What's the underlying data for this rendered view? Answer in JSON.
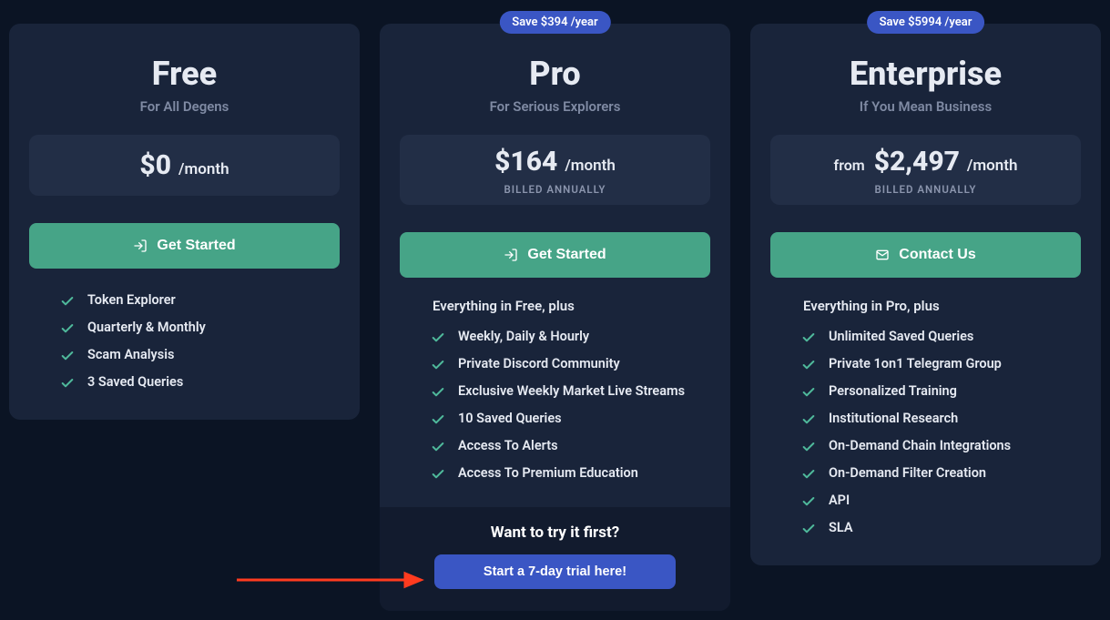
{
  "plans": {
    "free": {
      "title": "Free",
      "subtitle": "For All Degens",
      "price_amount": "$0",
      "price_period": "/month",
      "cta_label": "Get Started",
      "features": [
        "Token Explorer",
        "Quarterly & Monthly",
        "Scam Analysis",
        "3 Saved Queries"
      ]
    },
    "pro": {
      "badge": "Save $394 /year",
      "title": "Pro",
      "subtitle": "For Serious Explorers",
      "price_amount": "$164",
      "price_period": "/month",
      "billed": "BILLED ANNUALLY",
      "cta_label": "Get Started",
      "intro": "Everything in Free, plus",
      "features": [
        "Weekly, Daily & Hourly",
        "Private Discord Community",
        "Exclusive Weekly Market Live Streams",
        "10 Saved Queries",
        "Access To Alerts",
        "Access To Premium Education"
      ],
      "try_title": "Want to try it first?",
      "trial_label": "Start a 7-day trial here!"
    },
    "enterprise": {
      "badge": "Save $5994 /year",
      "title": "Enterprise",
      "subtitle": "If You Mean Business",
      "price_prefix": "from",
      "price_amount": "$2,497",
      "price_period": "/month",
      "billed": "BILLED ANNUALLY",
      "cta_label": "Contact Us",
      "intro": "Everything in Pro, plus",
      "features": [
        "Unlimited Saved Queries",
        "Private 1on1 Telegram Group",
        "Personalized Training",
        "Institutional Research",
        "On-Demand Chain Integrations",
        "On-Demand Filter Creation",
        "API",
        "SLA"
      ]
    }
  },
  "colors": {
    "accent_green": "#46a487",
    "accent_blue": "#3a56c4",
    "check": "#4fb99b"
  }
}
